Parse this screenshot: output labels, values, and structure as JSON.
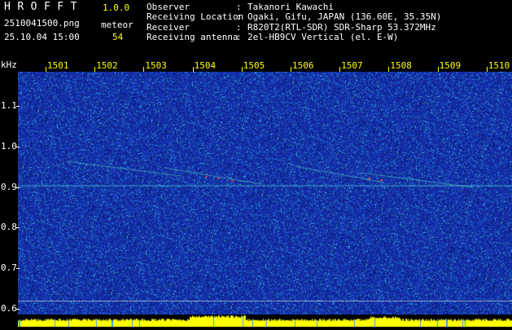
{
  "header": {
    "app_title": "HROFFT",
    "app_version": "1.0.0",
    "file_name": "2510041500.png",
    "datetime": "25.10.04 15:00",
    "mode_label": "meteor",
    "count": "54",
    "info": [
      {
        "key": "Observer",
        "value": "Takanori Kawachi"
      },
      {
        "key": "Receiving Location",
        "value": "Ogaki, Gifu, JAPAN (136.60E, 35.35N)"
      },
      {
        "key": "Receiver",
        "value": "R820T2(RTL-SDR) SDR-Sharp 53.372MHz"
      },
      {
        "key": "Receiving antenna",
        "value": "2el-HB9CV Vertical (el. E-W)"
      }
    ]
  },
  "axis": {
    "unit": "kHz",
    "time_ticks": [
      "1501",
      "1502",
      "1503",
      "1504",
      "1505",
      "1506",
      "1507",
      "1508",
      "1509",
      "1510"
    ],
    "freq_ticks": [
      {
        "label": "1.1",
        "value": 1.1
      },
      {
        "label": "1.0",
        "value": 1.0
      },
      {
        "label": "0.9",
        "value": 0.9
      },
      {
        "label": "0.8",
        "value": 0.8
      },
      {
        "label": "0.7",
        "value": 0.7
      },
      {
        "label": "0.6",
        "value": 0.6
      }
    ]
  },
  "colors": {
    "background": "#000000",
    "plot_base": "#1b3aa8",
    "label_yellow": "#ffff00",
    "label_white": "#ffffff"
  }
}
